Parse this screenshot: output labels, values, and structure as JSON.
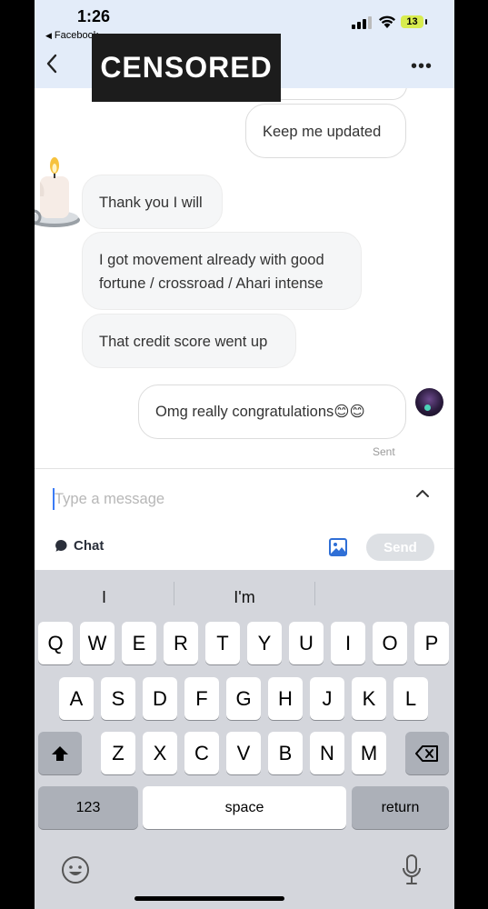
{
  "status_bar": {
    "time": "1:26",
    "back_app": "Facebook",
    "battery": "13"
  },
  "header": {
    "censored_label": "CENSORED",
    "more_label": "•••"
  },
  "messages": [
    {
      "side": "outgoing",
      "text": "Keep me updated"
    },
    {
      "side": "incoming",
      "text": "Thank you I will"
    },
    {
      "side": "incoming",
      "text": "I got movement already with good fortune / crossroad / Ahari intense"
    },
    {
      "side": "incoming",
      "text": "That credit score went up"
    },
    {
      "side": "outgoing",
      "text": "Omg really congratulations😊😊"
    }
  ],
  "message_status": "Sent",
  "composer": {
    "placeholder": "Type a message",
    "chat_tab_label": "Chat",
    "send_label": "Send"
  },
  "keyboard": {
    "suggestions": [
      "I",
      "I'm",
      ""
    ],
    "row1": [
      "Q",
      "W",
      "E",
      "R",
      "T",
      "Y",
      "U",
      "I",
      "O",
      "P"
    ],
    "row2": [
      "A",
      "S",
      "D",
      "F",
      "G",
      "H",
      "J",
      "K",
      "L"
    ],
    "row3": [
      "Z",
      "X",
      "C",
      "V",
      "B",
      "N",
      "M"
    ],
    "numbers_label": "123",
    "space_label": "space",
    "return_label": "return"
  },
  "icons": {
    "back": "chevron-left-icon",
    "more": "more-horizontal-icon",
    "expand": "chevron-up-icon",
    "chat": "chat-bubble-icon",
    "image": "image-icon",
    "shift": "shift-icon",
    "delete": "backspace-icon",
    "emoji": "emoji-icon",
    "mic": "microphone-icon"
  },
  "colors": {
    "header_bg": "#e3ecf9",
    "caret": "#3a7bf6",
    "image_icon": "#2f6fd6",
    "send_disabled": "#dde0e4"
  }
}
